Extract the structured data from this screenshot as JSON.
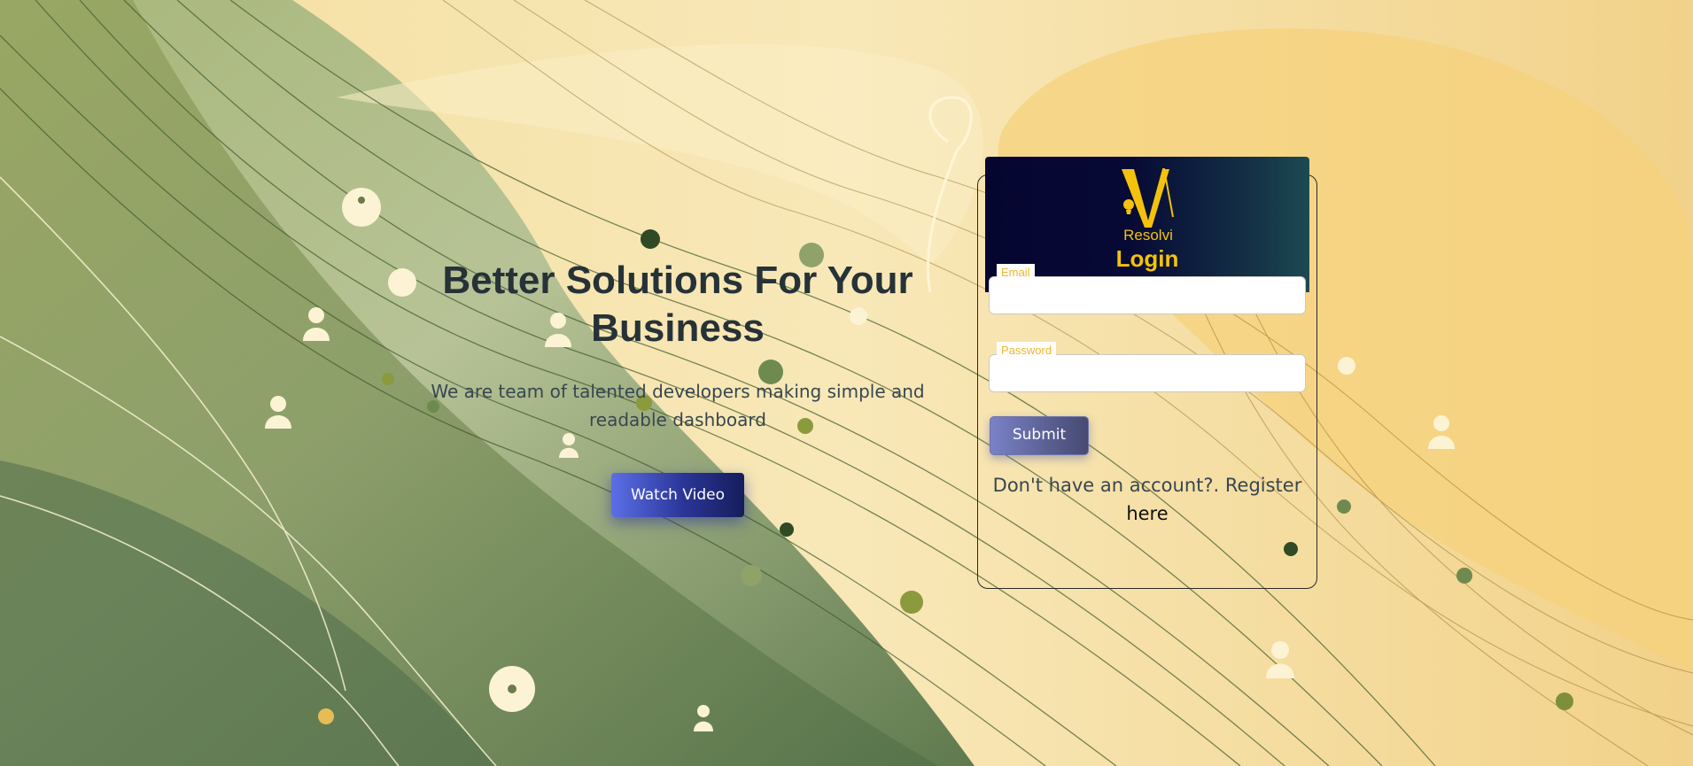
{
  "hero": {
    "title": "Better Solutions For Your Business",
    "subtitle": "We are team of talented developers making simple and readable dashboard",
    "watch_button": "Watch Video"
  },
  "login": {
    "brand": "Resolvi",
    "title": "Login",
    "email_label": "Email",
    "email_value": "",
    "password_label": "Password",
    "password_value": "",
    "submit_label": "Submit",
    "register_text": "Don't have an account?. Register",
    "register_link": "here"
  },
  "colors": {
    "accent_gold": "#f4c20d",
    "header_dark": "#050530",
    "button_blue": "#2a3596",
    "heading_text": "#263238"
  }
}
